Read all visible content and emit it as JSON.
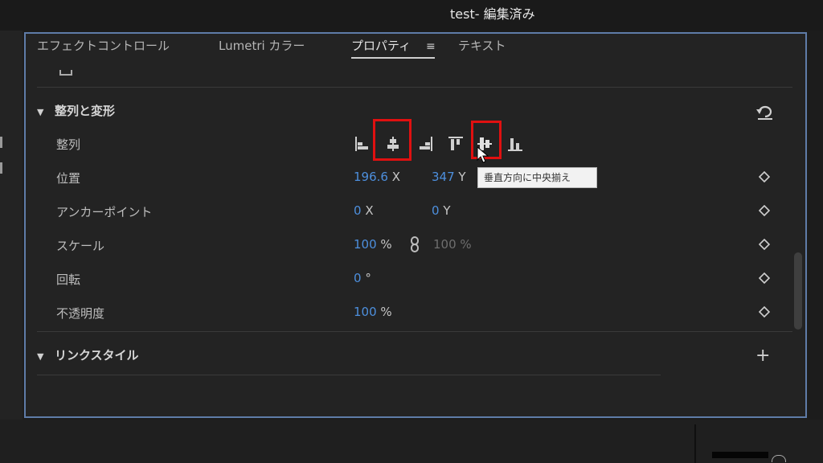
{
  "window": {
    "title": "test- 編集済み"
  },
  "tabs": [
    {
      "label": "エフェクトコントロール"
    },
    {
      "label": "Lumetri カラー"
    },
    {
      "label": "プロパティ",
      "active": true
    },
    {
      "label": "テキスト"
    }
  ],
  "tab_menu_icon": "≡",
  "sections": {
    "align_transform": {
      "title": "整列と変形",
      "expanded": true
    },
    "link_style": {
      "title": "リンクスタイル",
      "expanded": true
    }
  },
  "props": {
    "align": {
      "label": "整列"
    },
    "position": {
      "label": "位置",
      "x": "196.6",
      "x_unit": "X",
      "y": "347",
      "y_unit": "Y"
    },
    "anchor": {
      "label": "アンカーポイント",
      "x": "0",
      "x_unit": "X",
      "y": "0",
      "y_unit": "Y"
    },
    "scale": {
      "label": "スケール",
      "value": "100",
      "unit": "%",
      "linked_value": "100 %"
    },
    "rotation": {
      "label": "回転",
      "value": "0",
      "unit": "°"
    },
    "opacity": {
      "label": "不透明度",
      "value": "100",
      "unit": "%"
    }
  },
  "tooltip": "垂直方向に中央揃え",
  "icons": [
    "align-left-icon",
    "align-horizontal-center-icon",
    "align-right-icon",
    "align-top-icon",
    "align-vertical-center-icon",
    "align-bottom-icon",
    "reset-icon",
    "keyframe-diamond-icon",
    "link-chain-icon",
    "plus-icon",
    "chevron-down-icon",
    "cursor-icon"
  ],
  "colors": {
    "accent_value": "#4d8fdd",
    "highlight_box": "#e01010",
    "panel_border": "#5f7ca8"
  }
}
